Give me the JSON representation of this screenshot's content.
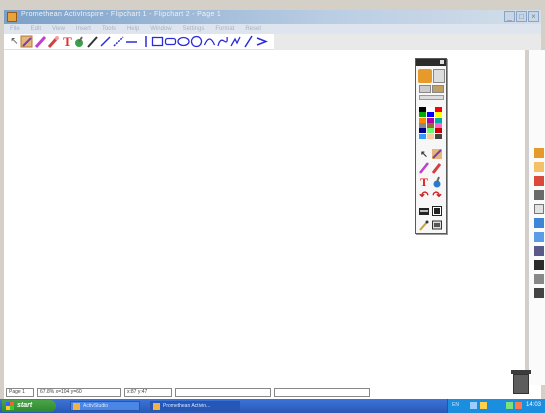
{
  "window": {
    "title": "Promethean ActivInspire - Flipchart 1 - Flipchart 2 - Page 1",
    "controls": {
      "minimize": "_",
      "maximize": "□",
      "close": "×"
    }
  },
  "menu": [
    "File",
    "Edit",
    "View",
    "Insert",
    "Tools",
    "Help",
    "Window",
    "Settings",
    "Format",
    "Reset"
  ],
  "toolbar": {
    "tools": [
      "select",
      "pen",
      "highlighter",
      "eraser",
      "text",
      "fill",
      "marker",
      "line",
      "dash",
      "rectangle",
      "rounded-rectangle",
      "ellipse",
      "circle",
      "arc",
      "curve",
      "freehand",
      "arrow"
    ]
  },
  "palette": {
    "colors": [
      "#000000",
      "#ffffff",
      "#ff0000",
      "#00aa00",
      "#0000ff",
      "#ffff00",
      "#ff8800",
      "#aa00aa",
      "#00aaaa",
      "#888888",
      "#996633",
      "#ff66cc",
      "#000088",
      "#66ff66",
      "#cc0000",
      "#3399ff",
      "#ffcc99",
      "#444444"
    ]
  },
  "status": {
    "page": "Page 1",
    "zoom": "67.8%  x=104  y=60",
    "position": "x:87  y:47",
    "extra": ""
  },
  "taskbar": {
    "start": "start",
    "items": [
      "ActivStudio",
      "Promethean Activin..."
    ],
    "lang": "EN",
    "clock": "14:03"
  }
}
